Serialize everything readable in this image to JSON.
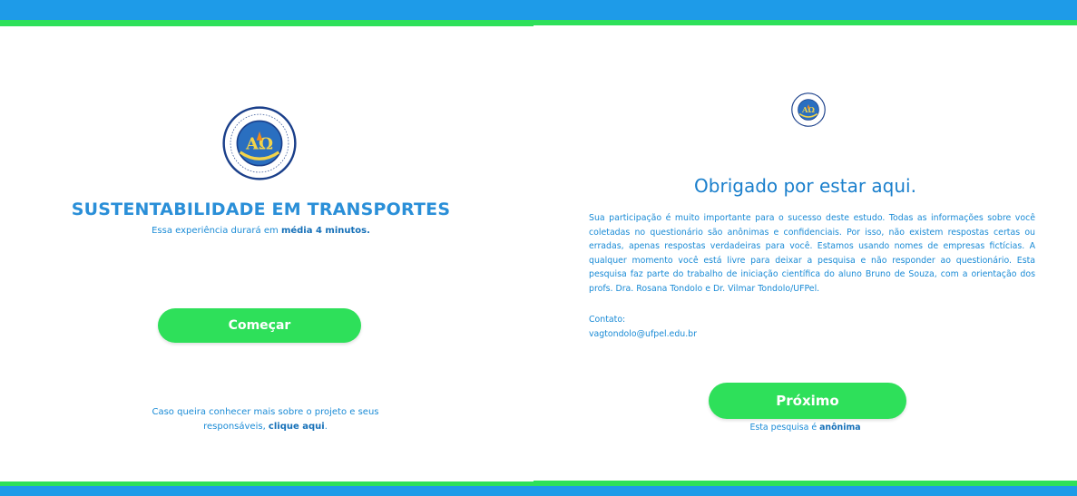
{
  "colors": {
    "blue_bar": "#1e9be8",
    "green_bar": "#2ee05a",
    "button_green": "#2ee05a",
    "title_blue": "#2a8fd8",
    "text_blue": "#1a8bd6"
  },
  "logo": {
    "ring_text": "UNIVERSIDADE FEDERAL DE PELOTAS",
    "bottom_text": "RS-BRASIL",
    "monogram": "AO"
  },
  "left_panel": {
    "title": "SUSTENTABILIDADE EM TRANSPORTES",
    "duration_prefix": "Essa experiência durará em ",
    "duration_emphasis": "média 4 minutos.",
    "start_button": "Começar",
    "info_prefix": "Caso queira conhecer mais sobre o projeto e seus responsáveis, ",
    "info_link": "clique aqui",
    "info_suffix": "."
  },
  "right_panel": {
    "title": "Obrigado por estar aqui.",
    "body": "Sua participação é muito importante para o sucesso deste estudo. Todas as informações sobre você coletadas no questionário são anônimas e confidenciais. Por isso, não existem respostas certas ou erradas, apenas respostas verdadeiras para você. Estamos usando nomes de empresas fictícias. A qualquer momento você está livre para deixar a pesquisa e não responder ao questionário. Esta pesquisa faz parte do trabalho de iniciação científica do aluno Bruno de Souza, com a orientação dos profs. Dra. Rosana Tondolo e Dr. Vilmar Tondolo/UFPel.",
    "contact_label": "Contato:",
    "contact_email": "vagtondolo@ufpel.edu.br",
    "next_button": "Próximo",
    "anon_prefix": "Esta pesquisa é ",
    "anon_emphasis": "anônima"
  }
}
